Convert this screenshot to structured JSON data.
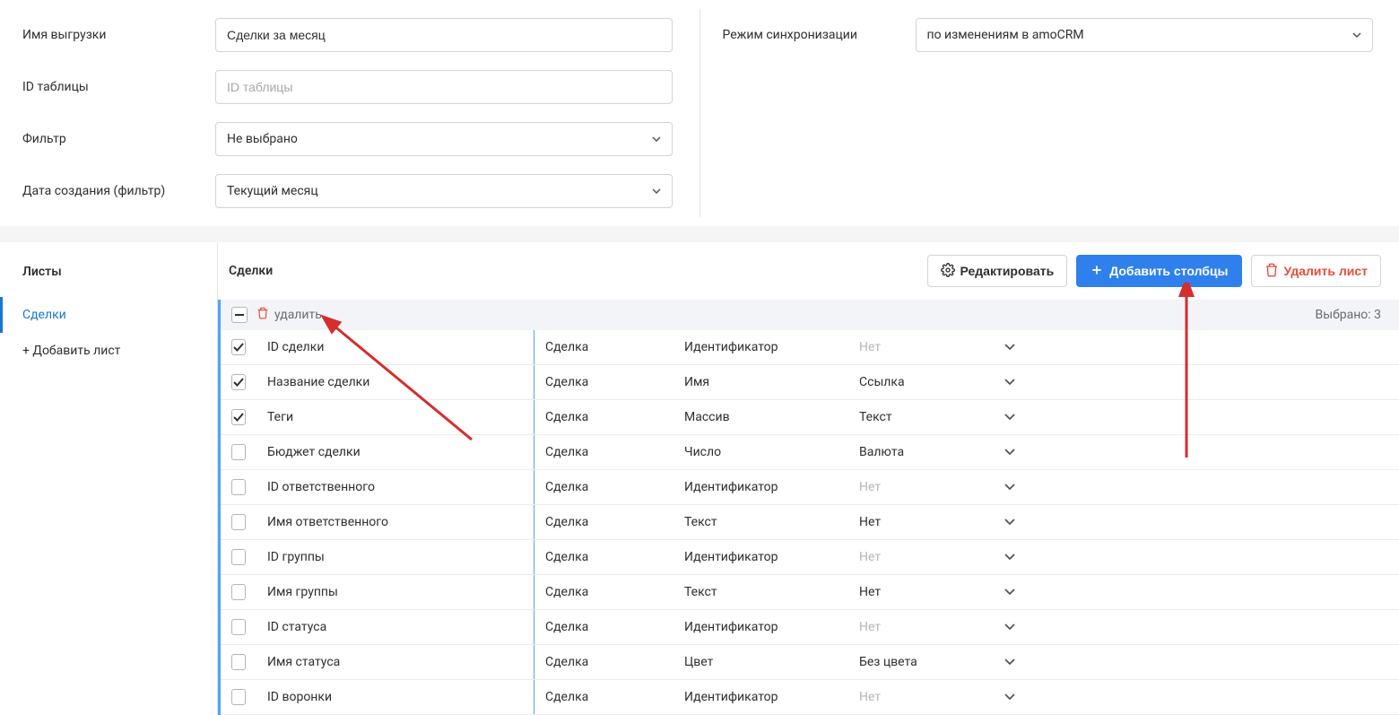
{
  "form": {
    "export_name_label": "Имя выгрузки",
    "export_name_value": "Сделки за месяц",
    "table_id_label": "ID таблицы",
    "table_id_placeholder": "ID таблицы",
    "filter_label": "Фильтр",
    "filter_value": "Не выбрано",
    "date_filter_label": "Дата создания (фильтр)",
    "date_filter_value": "Текущий месяц",
    "sync_mode_label": "Режим синхронизации",
    "sync_mode_value": "по изменениям в amoCRM"
  },
  "sidebar": {
    "title": "Листы",
    "items": [
      {
        "label": "Сделки"
      }
    ],
    "add_label": "+ Добавить лист"
  },
  "main": {
    "title": "Сделки",
    "edit_label": "Редактировать",
    "add_cols_label": "Добавить столбцы",
    "delete_sheet_label": "Удалить лист"
  },
  "bulk": {
    "delete_label": "удалить",
    "selected_label": "Выбрано: 3"
  },
  "rows": [
    {
      "checked": true,
      "name": "ID сделки",
      "entity": "Сделка",
      "type": "Идентификатор",
      "format": "Нет",
      "muted": true
    },
    {
      "checked": true,
      "name": "Название сделки",
      "entity": "Сделка",
      "type": "Имя",
      "format": "Ссылка",
      "muted": false
    },
    {
      "checked": true,
      "name": "Теги",
      "entity": "Сделка",
      "type": "Массив",
      "format": "Текст",
      "muted": false
    },
    {
      "checked": false,
      "name": "Бюджет сделки",
      "entity": "Сделка",
      "type": "Число",
      "format": "Валюта",
      "muted": false
    },
    {
      "checked": false,
      "name": "ID ответственного",
      "entity": "Сделка",
      "type": "Идентификатор",
      "format": "Нет",
      "muted": true
    },
    {
      "checked": false,
      "name": "Имя ответственного",
      "entity": "Сделка",
      "type": "Текст",
      "format": "Нет",
      "muted": false
    },
    {
      "checked": false,
      "name": "ID группы",
      "entity": "Сделка",
      "type": "Идентификатор",
      "format": "Нет",
      "muted": true
    },
    {
      "checked": false,
      "name": "Имя группы",
      "entity": "Сделка",
      "type": "Текст",
      "format": "Нет",
      "muted": false
    },
    {
      "checked": false,
      "name": "ID статуса",
      "entity": "Сделка",
      "type": "Идентификатор",
      "format": "Нет",
      "muted": true
    },
    {
      "checked": false,
      "name": "Имя статуса",
      "entity": "Сделка",
      "type": "Цвет",
      "format": "Без цвета",
      "muted": false
    },
    {
      "checked": false,
      "name": "ID воронки",
      "entity": "Сделка",
      "type": "Идентификатор",
      "format": "Нет",
      "muted": true
    }
  ]
}
